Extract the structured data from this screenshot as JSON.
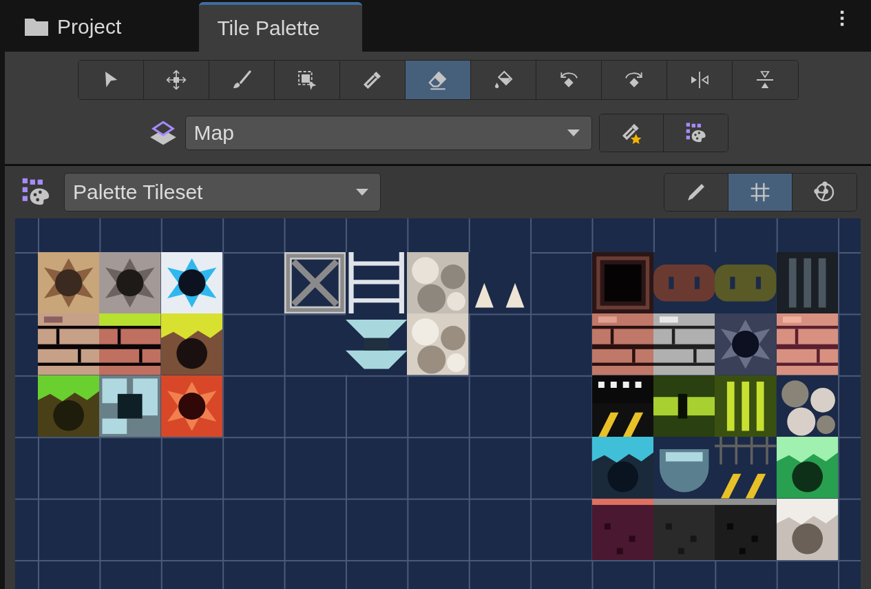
{
  "tabs": [
    {
      "label": "Project",
      "selected": false,
      "kind": "folder"
    },
    {
      "label": "Tile Palette",
      "selected": true,
      "kind": "plain"
    }
  ],
  "tools": [
    {
      "kind": "select",
      "selected": false
    },
    {
      "kind": "move",
      "selected": false
    },
    {
      "kind": "paint",
      "selected": false
    },
    {
      "kind": "box",
      "selected": false
    },
    {
      "kind": "pick",
      "selected": false
    },
    {
      "kind": "erase",
      "selected": true
    },
    {
      "kind": "fill",
      "selected": false
    },
    {
      "kind": "rotate_left",
      "selected": false
    },
    {
      "kind": "rotate_right",
      "selected": false
    },
    {
      "kind": "flip_x",
      "selected": false
    },
    {
      "kind": "flip_y",
      "selected": false
    }
  ],
  "active_target": {
    "value": "Map"
  },
  "palette": {
    "value": "Palette Tileset"
  },
  "view_toggles": [
    {
      "kind": "edit",
      "selected": false
    },
    {
      "kind": "grid",
      "selected": true
    },
    {
      "kind": "gizmo",
      "selected": false
    }
  ]
}
